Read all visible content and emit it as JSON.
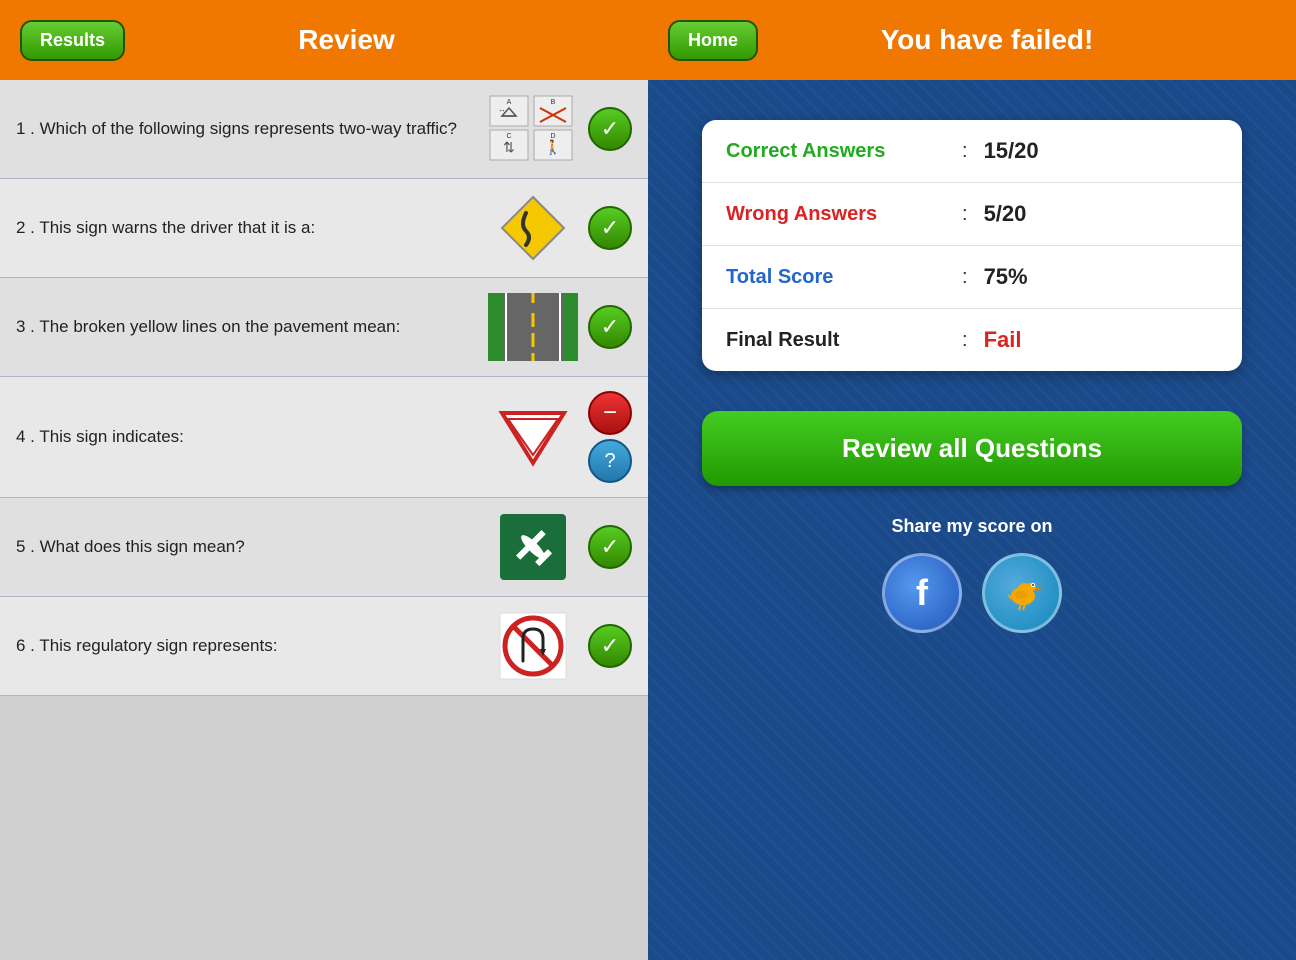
{
  "left": {
    "header": {
      "results_btn": "Results",
      "title": "Review"
    },
    "questions": [
      {
        "number": 1,
        "text": "Which of the following signs represents two-way traffic?",
        "status": "correct",
        "image_type": "sign-grid-traffic"
      },
      {
        "number": 2,
        "text": "This sign warns the driver that it is a:",
        "status": "correct",
        "image_type": "diamond-curve"
      },
      {
        "number": 3,
        "text": "The broken yellow lines on the pavement mean:",
        "status": "correct",
        "image_type": "road-lines"
      },
      {
        "number": 4,
        "text": "This sign indicates:",
        "status": "wrong",
        "status2": "unanswered",
        "image_type": "yield-triangle"
      },
      {
        "number": 5,
        "text": "What does this sign mean?",
        "status": "correct",
        "image_type": "airport"
      },
      {
        "number": 6,
        "text": "This regulatory sign represents:",
        "status": "correct",
        "image_type": "no-uturn"
      }
    ]
  },
  "right": {
    "header": {
      "home_btn": "Home",
      "title": "You have failed!"
    },
    "results": {
      "correct_label": "Correct Answers",
      "correct_value": "15/20",
      "wrong_label": "Wrong Answers",
      "wrong_value": "5/20",
      "score_label": "Total Score",
      "score_value": "75%",
      "final_label": "Final Result",
      "final_value": "Fail"
    },
    "review_btn": "Review all Questions",
    "share_label": "Share my score on",
    "social": {
      "facebook_label": "f",
      "twitter_label": "🐦"
    }
  }
}
